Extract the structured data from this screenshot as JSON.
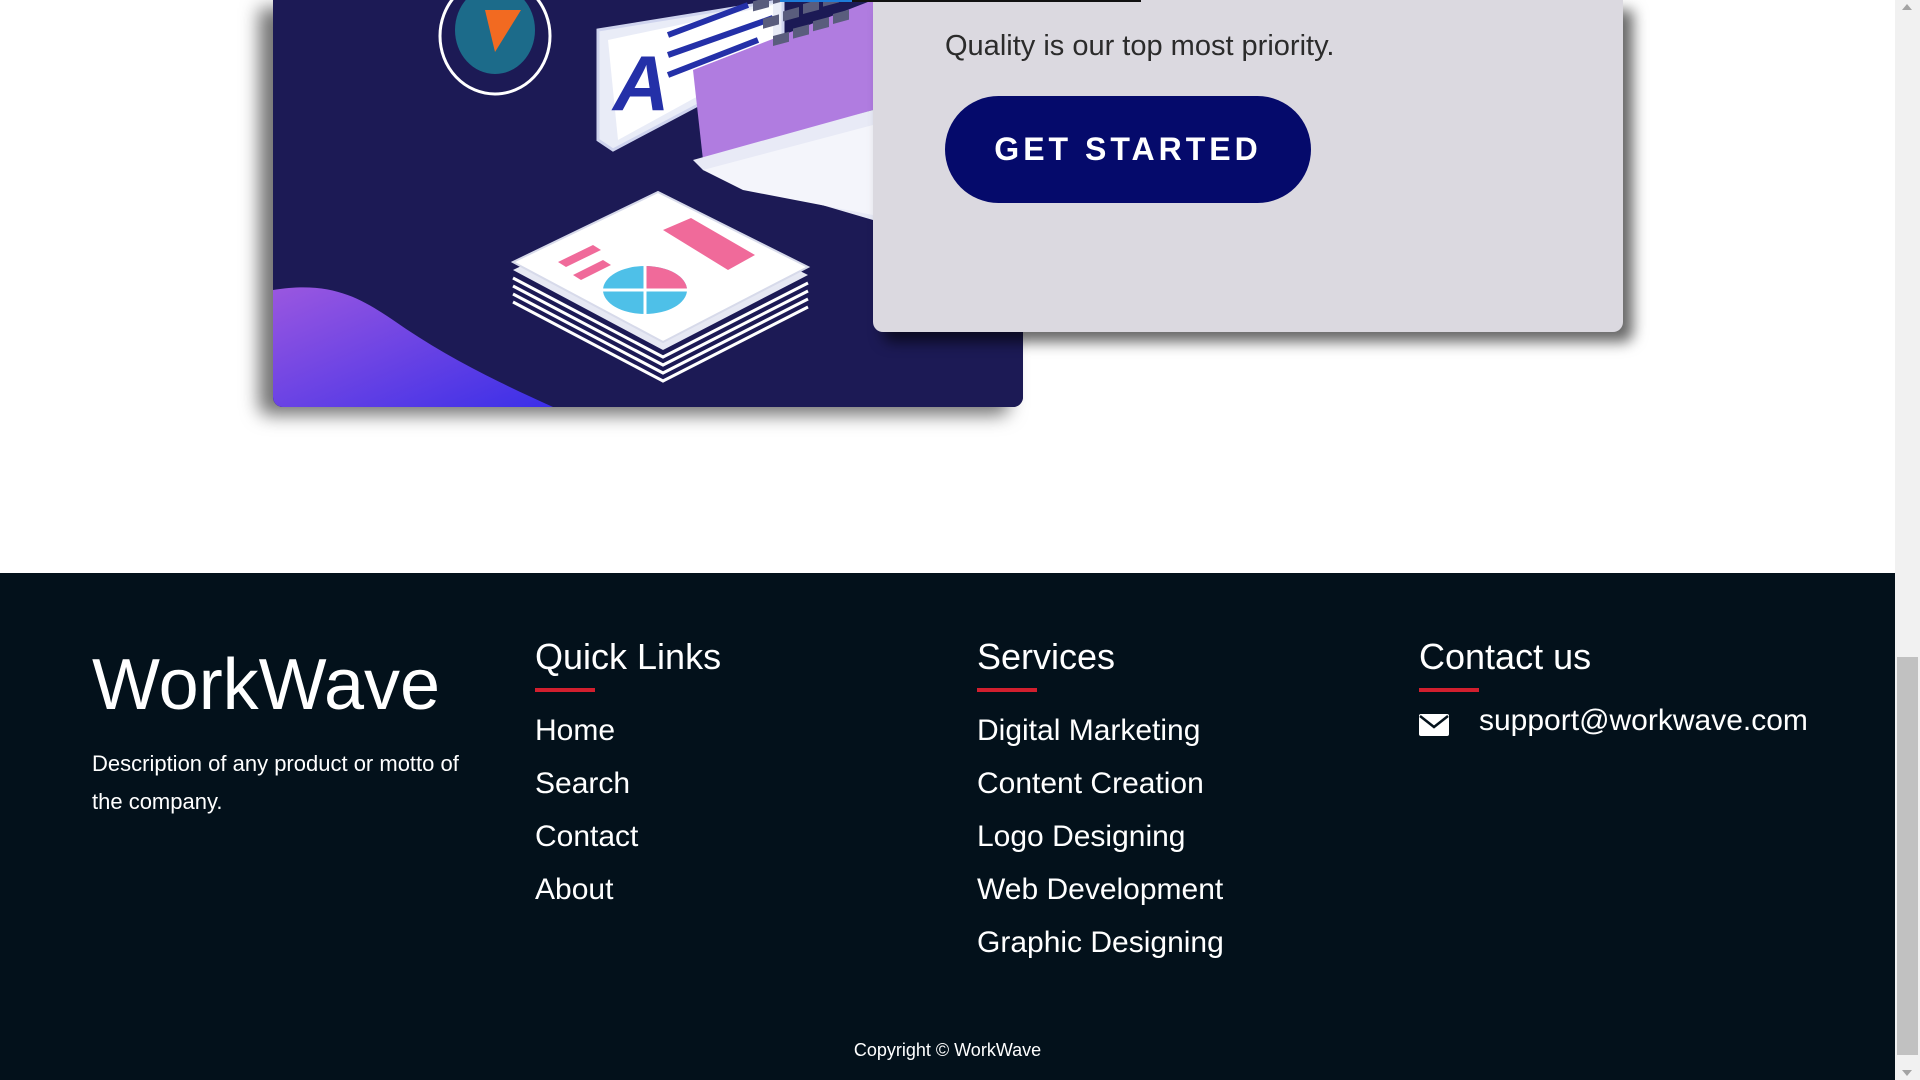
{
  "cta": {
    "text": "Quality is our top most priority.",
    "button_label": "GET STARTED"
  },
  "illustration": {
    "badge_letter": "A"
  },
  "footer": {
    "brand_name": "WorkWave",
    "brand_description": "Description of any product or motto of the company.",
    "quick_links": {
      "title": "Quick Links",
      "items": [
        {
          "label": "Home"
        },
        {
          "label": "Search"
        },
        {
          "label": "Contact"
        },
        {
          "label": "About"
        }
      ]
    },
    "services": {
      "title": "Services",
      "items": [
        {
          "label": "Digital Marketing"
        },
        {
          "label": "Content Creation"
        },
        {
          "label": "Logo Designing"
        },
        {
          "label": "Web Development"
        },
        {
          "label": "Graphic Designing"
        }
      ]
    },
    "contact": {
      "title": "Contact us",
      "email": "support@workwave.com",
      "icon": "envelope-icon"
    },
    "copyright": "Copyright © WorkWave"
  },
  "colors": {
    "footer_bg": "#03111b",
    "accent_red": "#d21f2e",
    "button_bg": "#050a6b",
    "card_bg": "#dbd9e0"
  }
}
